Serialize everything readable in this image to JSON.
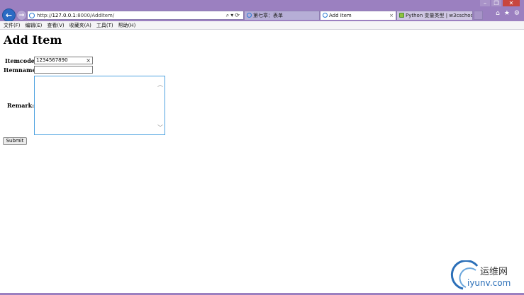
{
  "browser": {
    "address": {
      "prefix": "http://",
      "host": "127.0.0.1",
      "rest": ":8000/AddItem/"
    },
    "tabs": [
      {
        "label": "第七章：表单"
      },
      {
        "label": "Add Item",
        "close": "×"
      },
      {
        "label": "Python 变量类型 | w3cschool..."
      }
    ],
    "accent_color": "#9b80c0"
  },
  "menu": [
    "文件(F)",
    "编辑(E)",
    "查看(V)",
    "收藏夹(A)",
    "工具(T)",
    "帮助(H)"
  ],
  "page": {
    "title": "Add Item",
    "form": {
      "itemcode_label": "Itemcode:",
      "itemcode_value": "1234567890",
      "itemname_label": "Itemname:",
      "itemname_value": "",
      "remark_label": "Remark:",
      "remark_value": "",
      "submit_label": "Submit"
    }
  },
  "watermark": {
    "cn": "运维网",
    "en": "iyunv.com"
  }
}
